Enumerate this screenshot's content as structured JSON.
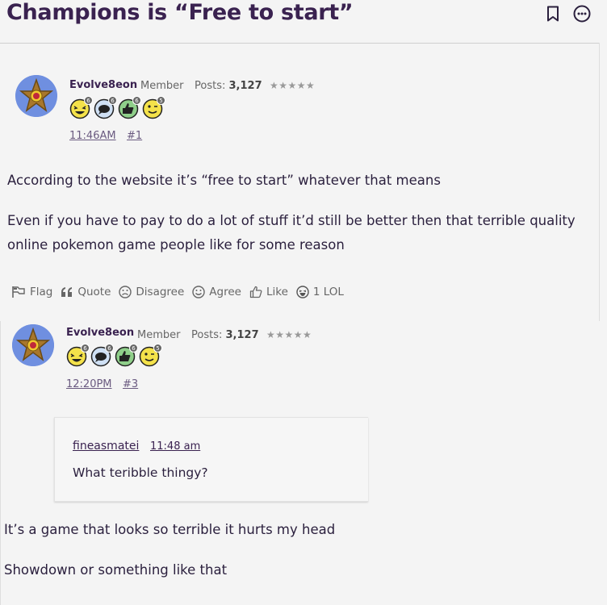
{
  "thread": {
    "title": "Champions is “Free to start”"
  },
  "header": {
    "bookmark_icon": "bookmark-icon",
    "more_icon": "more-options-icon"
  },
  "colors": {
    "accent": "#3a2250",
    "avatar_bg": "#6f8fe0"
  },
  "posts": [
    {
      "username": "Evolve8eon",
      "role": "Member",
      "posts_label": "Posts:",
      "posts_count": "3,127",
      "stars": "★★★★★",
      "badges": [
        {
          "icon": "laughing-face-badge",
          "count": "6"
        },
        {
          "icon": "speech-bubble-badge",
          "count": "6"
        },
        {
          "icon": "thumbs-up-badge",
          "count": "6"
        },
        {
          "icon": "wink-face-badge",
          "count": "5"
        }
      ],
      "time": "11:46AM",
      "number": "#1",
      "paragraphs": [
        "According to the website it’s “free to start” whatever that means",
        "Even if you have to pay to do a lot of stuff it’d still be better then that terrible quality",
        "online pokemon game people like for some reason"
      ],
      "actions": {
        "flag": "Flag",
        "quote": "Quote",
        "disagree": "Disagree",
        "agree": "Agree",
        "like": "Like",
        "lol": "1 LOL"
      }
    },
    {
      "username": "Evolve8eon",
      "role": "Member",
      "posts_label": "Posts:",
      "posts_count": "3,127",
      "stars": "★★★★★",
      "badges": [
        {
          "icon": "laughing-face-badge",
          "count": "6"
        },
        {
          "icon": "speech-bubble-badge",
          "count": "6"
        },
        {
          "icon": "thumbs-up-badge",
          "count": "6"
        },
        {
          "icon": "wink-face-badge",
          "count": "5"
        }
      ],
      "time": "12:20PM",
      "number": "#3",
      "quote": {
        "author": "fineasmatei",
        "time": "11:48 am",
        "text": "What teribble thingy?"
      },
      "paragraphs": [
        "It’s a game that looks so terrible it hurts my head",
        "Showdown or something like that"
      ]
    }
  ]
}
